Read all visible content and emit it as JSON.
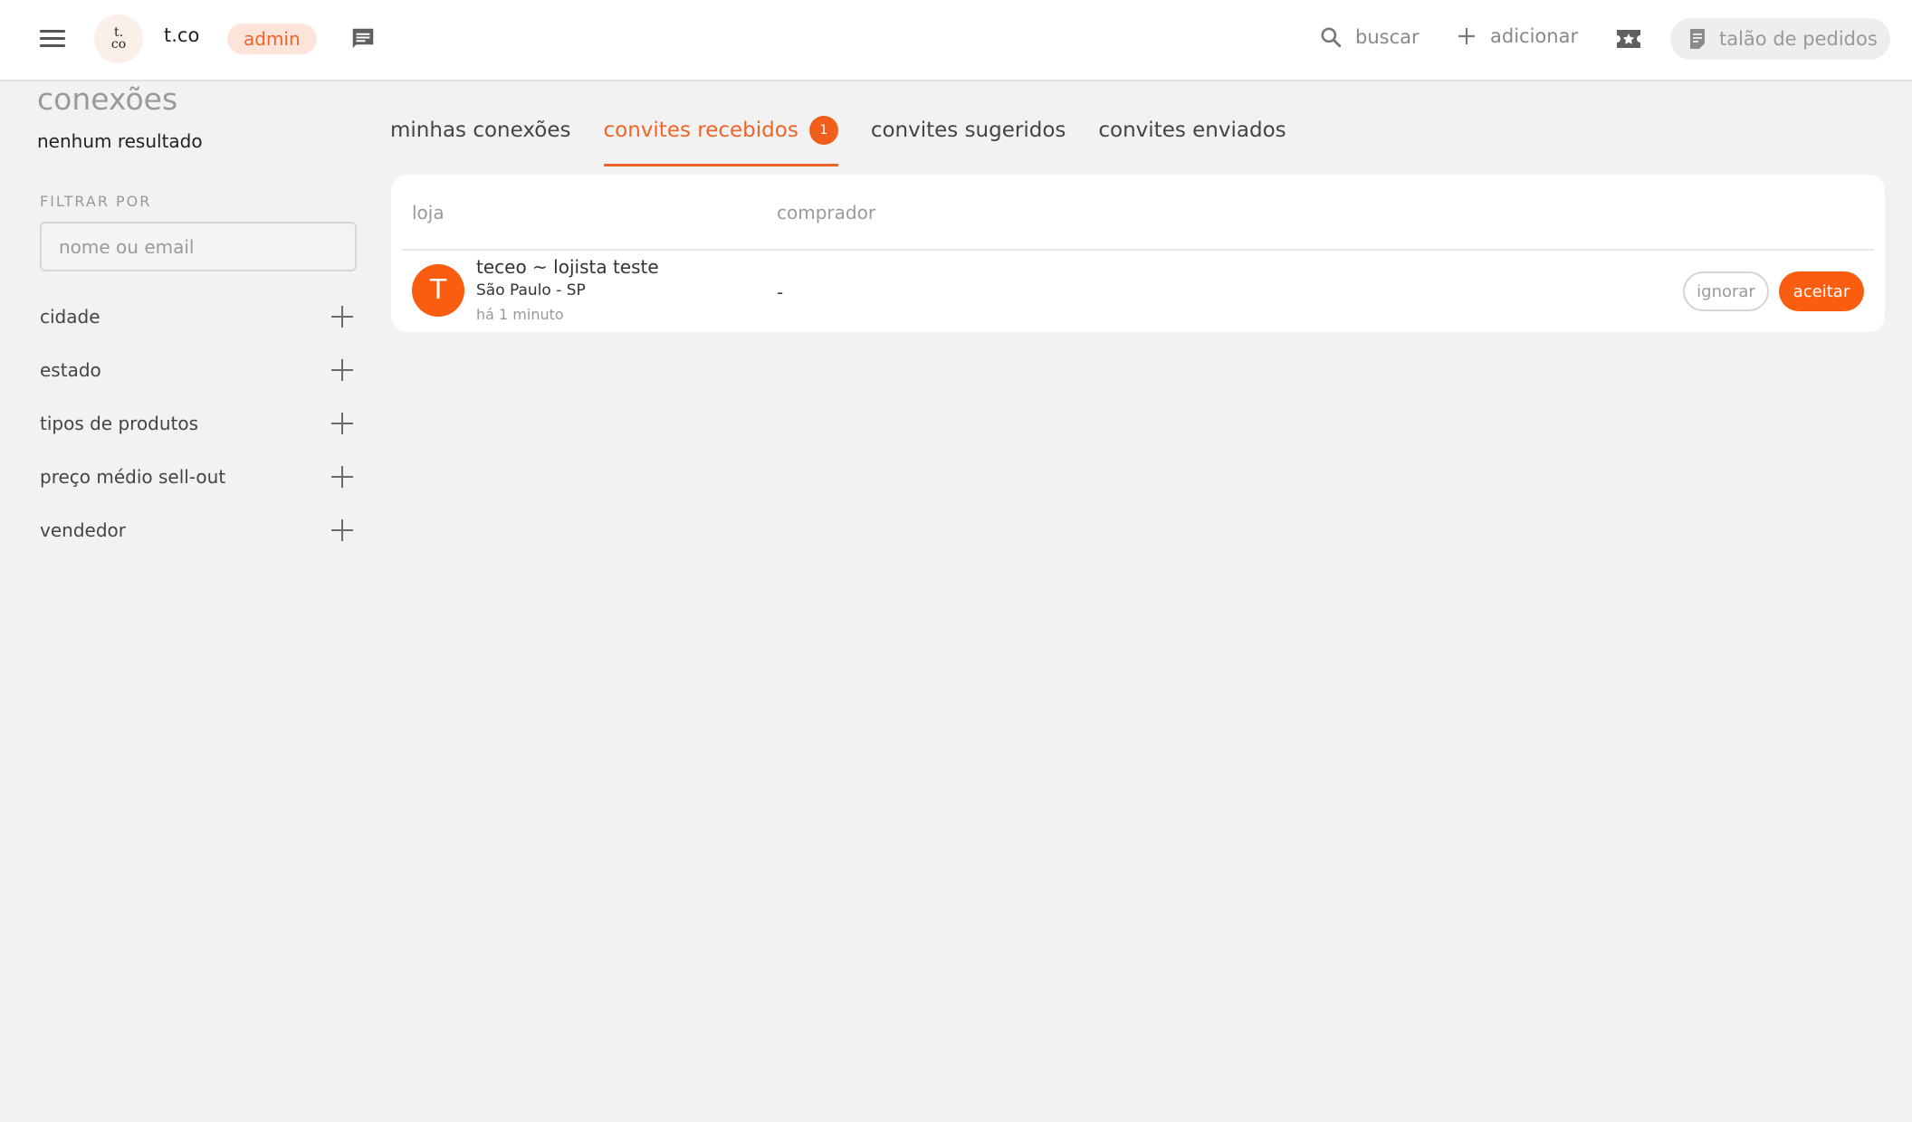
{
  "header": {
    "logo_text": "t.co",
    "logo_mark": "t.\nco",
    "company_name": "t.co",
    "role_badge": "admin",
    "search_label": "buscar",
    "add_label": "adicionar",
    "orders_label": "talão de pedidos",
    "icons": {
      "menu": "hamburger-menu-icon",
      "messages": "chat-icon",
      "search": "search-icon",
      "add": "plus-icon",
      "promotions": "ticket-star-icon",
      "orders": "document-icon"
    }
  },
  "sidebar": {
    "title": "conexões",
    "result_count": "nenhum resultado",
    "filter_heading": "FILTRAR POR",
    "search_placeholder": "nome ou email",
    "search_value": "",
    "filters": [
      {
        "label": "cidade"
      },
      {
        "label": "estado"
      },
      {
        "label": "tipos de produtos"
      },
      {
        "label": "preço médio sell-out"
      },
      {
        "label": "vendedor"
      }
    ]
  },
  "tabs": [
    {
      "label": "minhas conexões",
      "active": false
    },
    {
      "label": "convites recebidos",
      "active": true,
      "count": "1"
    },
    {
      "label": "convites sugeridos",
      "active": false
    },
    {
      "label": "convites enviados",
      "active": false
    }
  ],
  "table": {
    "columns": {
      "loja": "loja",
      "comprador": "comprador"
    },
    "rows": [
      {
        "avatar_initial": "T",
        "store_name": "teceo ~ lojista teste",
        "location": "São Paulo - SP",
        "time": "há 1 minuto",
        "buyer": "-",
        "ignore_label": "ignorar",
        "accept_label": "aceitar"
      }
    ]
  },
  "colors": {
    "accent": "#f06427",
    "accent_button": "#fa5d0f",
    "badge_bg": "#fde4db",
    "page_bg": "#f2f2f2"
  }
}
